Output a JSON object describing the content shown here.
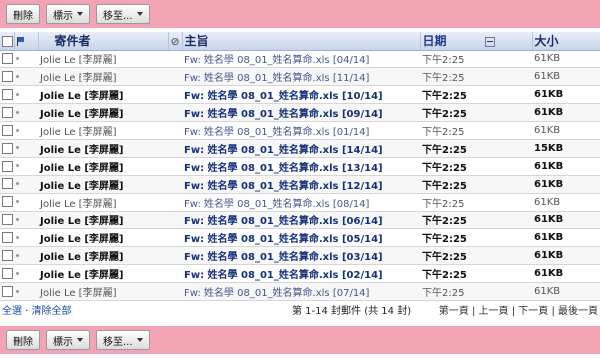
{
  "toolbar": {
    "delete_label": "刪除",
    "mark_label": "標示",
    "move_label": "移至..."
  },
  "columns": {
    "sender": "寄件者",
    "subject": "主旨",
    "date": "日期",
    "size": "大小"
  },
  "emails": [
    {
      "sender": "Jolie Le [李屏麗]",
      "subject": "Fw: 姓名學 08_01_姓名算命.xls [04/14]",
      "date": "下午2:25",
      "size": "61KB",
      "unread": false
    },
    {
      "sender": "Jolie Le [李屏麗]",
      "subject": "Fw: 姓名學 08_01_姓名算命.xls [11/14]",
      "date": "下午2:25",
      "size": "61KB",
      "unread": false
    },
    {
      "sender": "Jolie Le [李屏麗]",
      "subject": "Fw: 姓名學 08_01_姓名算命.xls [10/14]",
      "date": "下午2:25",
      "size": "61KB",
      "unread": true
    },
    {
      "sender": "Jolie Le [李屏麗]",
      "subject": "Fw: 姓名學 08_01_姓名算命.xls [09/14]",
      "date": "下午2:25",
      "size": "61KB",
      "unread": true
    },
    {
      "sender": "Jolie Le [李屏麗]",
      "subject": "Fw: 姓名學 08_01_姓名算命.xls [01/14]",
      "date": "下午2:25",
      "size": "61KB",
      "unread": false
    },
    {
      "sender": "Jolie Le [李屏麗]",
      "subject": "Fw: 姓名學 08_01_姓名算命.xls [14/14]",
      "date": "下午2:25",
      "size": "15KB",
      "unread": true
    },
    {
      "sender": "Jolie Le [李屏麗]",
      "subject": "Fw: 姓名學 08_01_姓名算命.xls [13/14]",
      "date": "下午2:25",
      "size": "61KB",
      "unread": true
    },
    {
      "sender": "Jolie Le [李屏麗]",
      "subject": "Fw: 姓名學 08_01_姓名算命.xls [12/14]",
      "date": "下午2:25",
      "size": "61KB",
      "unread": true
    },
    {
      "sender": "Jolie Le [李屏麗]",
      "subject": "Fw: 姓名學 08_01_姓名算命.xls [08/14]",
      "date": "下午2:25",
      "size": "61KB",
      "unread": false
    },
    {
      "sender": "Jolie Le [李屏麗]",
      "subject": "Fw: 姓名學 08_01_姓名算命.xls [06/14]",
      "date": "下午2:25",
      "size": "61KB",
      "unread": true
    },
    {
      "sender": "Jolie Le [李屏麗]",
      "subject": "Fw: 姓名學 08_01_姓名算命.xls [05/14]",
      "date": "下午2:25",
      "size": "61KB",
      "unread": true
    },
    {
      "sender": "Jolie Le [李屏麗]",
      "subject": "Fw: 姓名學 08_01_姓名算命.xls [03/14]",
      "date": "下午2:25",
      "size": "61KB",
      "unread": true
    },
    {
      "sender": "Jolie Le [李屏麗]",
      "subject": "Fw: 姓名學 08_01_姓名算命.xls [02/14]",
      "date": "下午2:25",
      "size": "61KB",
      "unread": true
    },
    {
      "sender": "Jolie Le [李屏麗]",
      "subject": "Fw: 姓名學 08_01_姓名算命.xls [07/14]",
      "date": "下午2:25",
      "size": "61KB",
      "unread": false
    }
  ],
  "footer": {
    "select_all": "全選",
    "separator": " · ",
    "clear_all": "清除全部",
    "count": "第 1-14 封郵件 (共 14 封)",
    "first_page": "第一頁",
    "prev_page": "上一頁",
    "next_page": "下一頁",
    "last_page": "最後一頁"
  },
  "colors": {
    "toolbar_bg": "#f2a4b5",
    "header_text": "#1a2c64",
    "link": "#1e4aa8"
  }
}
